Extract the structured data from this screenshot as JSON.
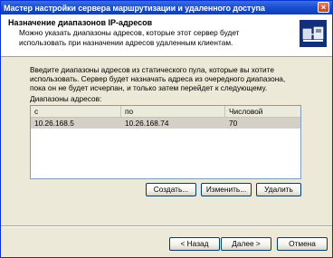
{
  "window": {
    "title": "Мастер настройки сервера маршрутизации и удаленного доступа",
    "close_glyph": "×"
  },
  "header": {
    "title": "Назначение диапазонов IP-адресов",
    "description": "Можно указать диапазоны адресов, которые этот сервер будет использовать при назначении адресов удаленным клиентам.",
    "icon": "network-wizard-icon"
  },
  "main": {
    "intro": "Введите диапазоны адресов из статического пула, которые вы хотите использовать. Сервер будет назначать адреса из очередного диапазона, пока он не будет исчерпан, и только затем перейдет к следующему.",
    "list_label": "Диапазоны адресов:",
    "columns": [
      "с",
      "по",
      "Числовой"
    ],
    "rows": [
      {
        "from": "10.26.168.5",
        "to": "10.26.168.74",
        "count": "70"
      }
    ],
    "buttons": {
      "create": "Создать...",
      "edit": "Изменить...",
      "delete": "Удалить"
    }
  },
  "footer": {
    "back": "< Назад",
    "next": "Далее >",
    "cancel": "Отмена"
  }
}
